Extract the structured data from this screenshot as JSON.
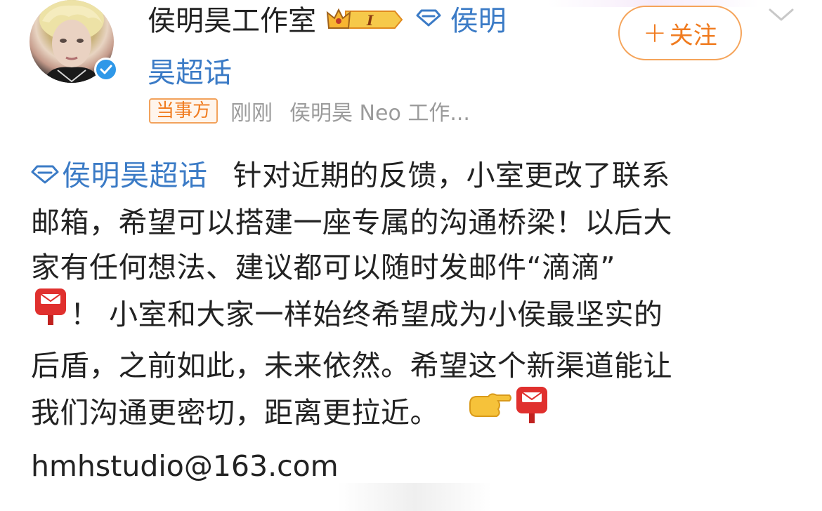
{
  "header": {
    "author_name": "侯明昊工作室",
    "member_level": "I",
    "topic_link_part1": "侯明",
    "topic_link_part2": "昊超话",
    "follow_label": "关注",
    "follow_plus": "+"
  },
  "meta": {
    "party_badge": "当事方",
    "time": "刚刚",
    "source": "侯明昊 Neo 工作..."
  },
  "post": {
    "topic": "侯明昊超话",
    "line1_text": "针对近期的反馈，小室更改了联系",
    "line2": "邮箱，希望可以搭建一座专属的沟通桥梁！以后大",
    "line3": "家有任何想法、建议都可以随时发邮件“滴滴”",
    "line4_text": "！ 小室和大家一样始终希望成为小侯最坚实的",
    "line5": "后盾，之前如此，未来依然。希望这个新渠道能让",
    "line6_text": "我们沟通更密切，距离更拉近。",
    "email": "hmhstudio@163.com"
  },
  "icons": {
    "verified": "verified-badge-icon",
    "crown": "crown-icon",
    "topic": "diamond-topic-icon",
    "mailbox": "postbox-icon",
    "pointing": "pointing-hand-icon",
    "chevron": "chevron-down-icon"
  },
  "colors": {
    "link_blue": "#3b7bc6",
    "orange": "#f07b1f",
    "verify_blue": "#2f98e8",
    "meta_gray": "#9b9b9b"
  }
}
